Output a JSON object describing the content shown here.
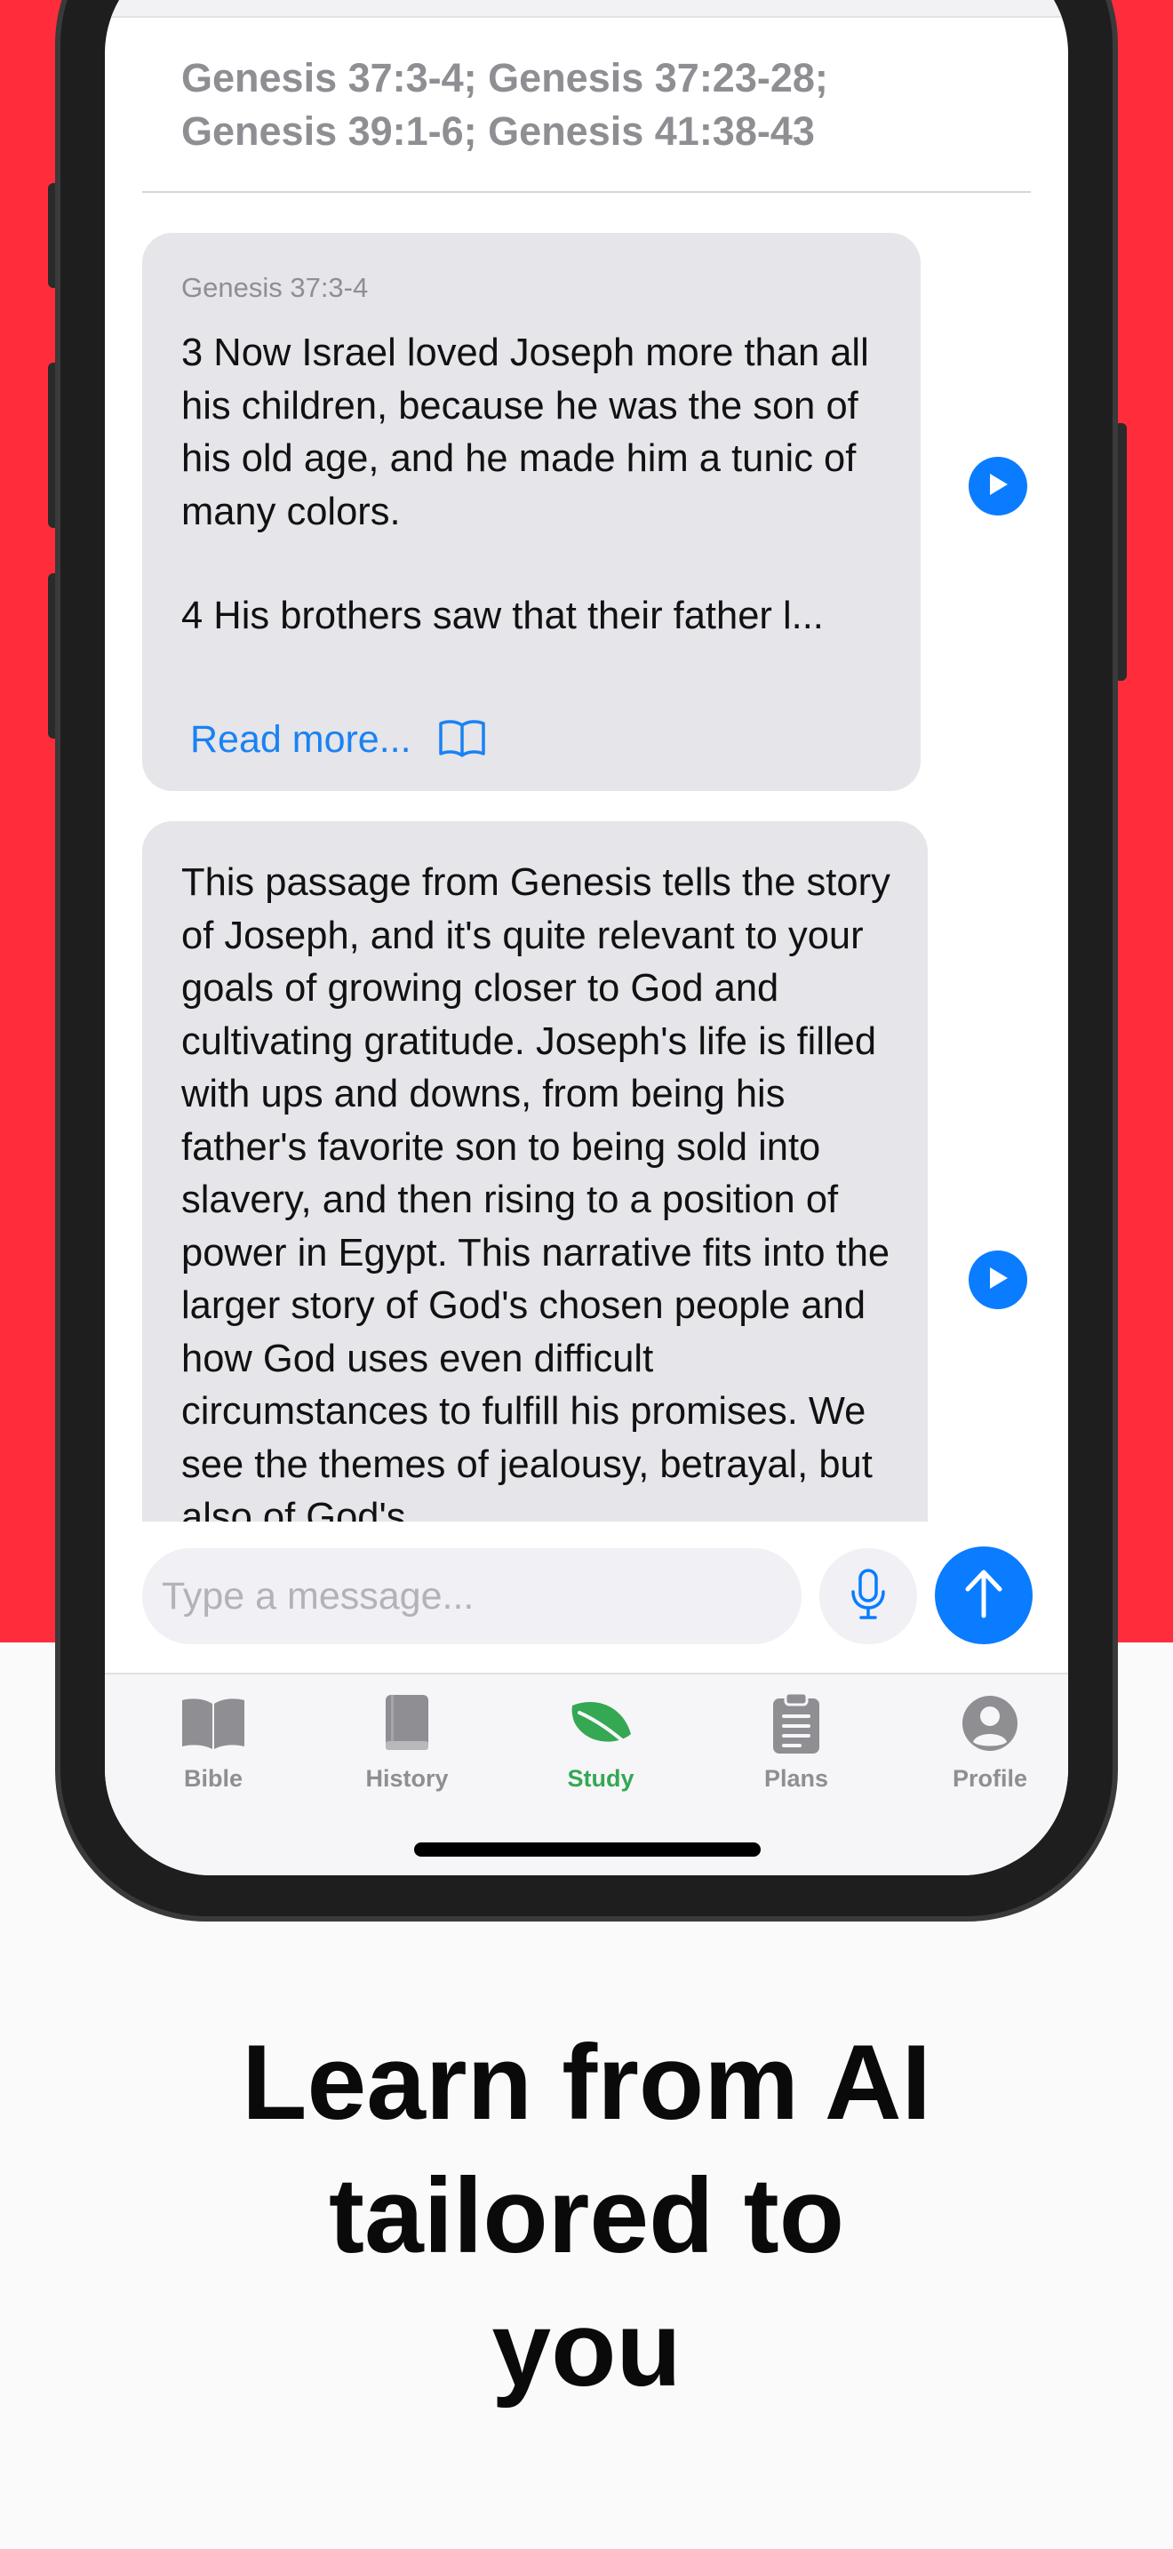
{
  "colors": {
    "background_red": "#ff2d3c",
    "accent_blue": "#0a7cff",
    "active_green": "#34a853",
    "bubble_gray": "#e5e5ea"
  },
  "chat": {
    "references": "Genesis 37:3-4; Genesis 37:23-28; Genesis 39:1-6; Genesis 41:38-43",
    "messages": [
      {
        "reference": "Genesis 37:3-4",
        "paragraph_1": "3 Now Israel loved Joseph more than all his children, because he was the son of his old age, and he made him a tunic of many colors.",
        "paragraph_2": "4 His brothers saw that their father l...",
        "read_more": "Read more...",
        "read_more_icon": "book-icon",
        "action_icon": "play-icon"
      },
      {
        "text": "This passage from Genesis tells the story of Joseph, and it's quite relevant to your goals of growing closer to God and cultivating gratitude. Joseph's life is filled with ups and downs, from being his father's favorite son to being sold into slavery, and then rising to a position of power in Egypt. This narrative fits into the larger story of God's chosen people and how God uses even difficult circumstances to fulfill his promises. We see the themes of jealousy, betrayal, but also of God's",
        "action_icon": "play-icon"
      }
    ]
  },
  "composer": {
    "placeholder": "Type a message...",
    "mic_icon": "microphone-icon",
    "send_icon": "arrow-up-icon"
  },
  "tabs": [
    {
      "label": "Bible",
      "icon": "open-book-icon",
      "active": false
    },
    {
      "label": "History",
      "icon": "closed-book-icon",
      "active": false
    },
    {
      "label": "Study",
      "icon": "leaf-icon",
      "active": true
    },
    {
      "label": "Plans",
      "icon": "clipboard-icon",
      "active": false
    },
    {
      "label": "Profile",
      "icon": "person-circle-icon",
      "active": false
    }
  ],
  "tagline": {
    "line_1": "Learn from AI",
    "line_2": "tailored to",
    "line_3": "you"
  }
}
